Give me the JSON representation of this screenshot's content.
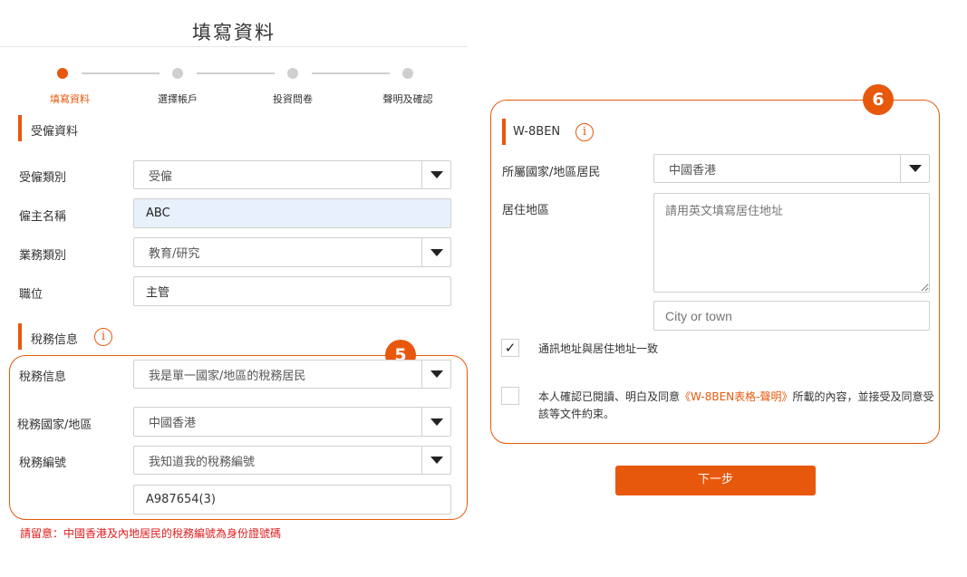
{
  "page": {
    "title": "填寫資料"
  },
  "steps": [
    {
      "label": "填寫資料",
      "active": true
    },
    {
      "label": "選擇帳戶",
      "active": false
    },
    {
      "label": "投資問卷",
      "active": false
    },
    {
      "label": "聲明及確認",
      "active": false
    }
  ],
  "employment": {
    "section_title": "受僱資料",
    "fields": [
      {
        "label": "受僱類別",
        "value": "受僱"
      },
      {
        "label": "僱主名稱",
        "value": "ABC"
      },
      {
        "label": "業務類別",
        "value": "教育/研究"
      },
      {
        "label": "職位",
        "value": "主管"
      }
    ]
  },
  "tax": {
    "section_title": "稅務信息",
    "info_icon": "info-icon",
    "callout_badge": "5",
    "fields": [
      {
        "label": "稅務信息",
        "value": "我是單一國家/地區的稅務居民"
      },
      {
        "label": "稅務國家/地區",
        "value": "中國香港"
      },
      {
        "label": "稅務編號",
        "value": "我知道我的稅務編號"
      }
    ],
    "tax_number_value": "A987654(3)",
    "note": "請留意：中國香港及內地居民的稅務編號為身份證號碼"
  },
  "w8ben": {
    "callout_badge": "6",
    "section_title": "W-8BEN",
    "info_icon": "info-icon",
    "residence_country_label": "所屬國家/地區居民",
    "residence_country_value": "中國香港",
    "address_label": "居住地區",
    "address_placeholder": "請用英文填寫居住地址",
    "city_placeholder": "City or town",
    "same_address_label": "通訊地址與居住地址一致",
    "same_address_checked": true,
    "agree_prefix": "本人確認已閱讀、明白及同意",
    "agree_link": "《W-8BEN表格-聲明》",
    "agree_suffix": "所載的內容，並接受及同意受該等文件約束。",
    "agree_checked": false
  },
  "actions": {
    "next_label": "下一步"
  },
  "colors": {
    "accent": "#e8580c",
    "warning_text": "#e01a1a",
    "filled_bg": "#e8f0fb"
  }
}
